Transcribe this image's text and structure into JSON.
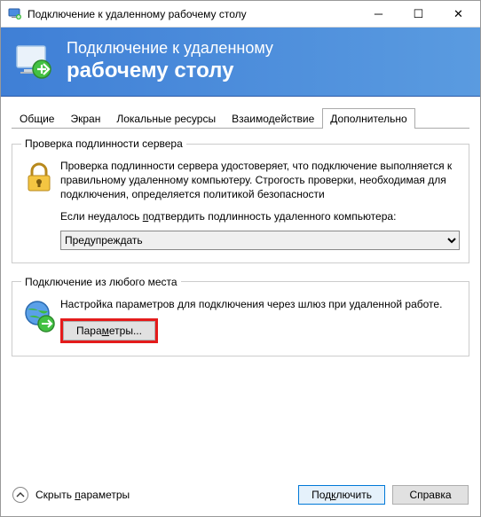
{
  "window": {
    "title": "Подключение к удаленному рабочему столу"
  },
  "banner": {
    "line1": "Подключение к удаленному",
    "line2": "рабочему столу"
  },
  "tabs": {
    "general": "Общие",
    "display": "Экран",
    "local": "Локальные ресурсы",
    "experience": "Взаимодействие",
    "advanced": "Дополнительно"
  },
  "auth": {
    "legend": "Проверка подлинности сервера",
    "desc": "Проверка подлинности сервера удостоверяет, что подключение выполняется к правильному удаленному компьютеру. Строгость проверки, необходимая для подключения, определяется политикой безопасности",
    "prompt_pre": "Если неудалось ",
    "prompt_hot": "п",
    "prompt_post": "одтвердить подлинность удаленного компьютера:",
    "select_value": "Предупреждать"
  },
  "anywhere": {
    "legend": "Подключение из любого места",
    "desc": "Настройка параметров для подключения через шлюз при удаленной работе.",
    "btn_pre": "Пара",
    "btn_hot": "м",
    "btn_post": "етры..."
  },
  "footer": {
    "hide_pre": "Скрыть ",
    "hide_hot": "п",
    "hide_post": "араметры",
    "connect_pre": "Под",
    "connect_hot": "к",
    "connect_post": "лючить",
    "help": "Справка"
  }
}
